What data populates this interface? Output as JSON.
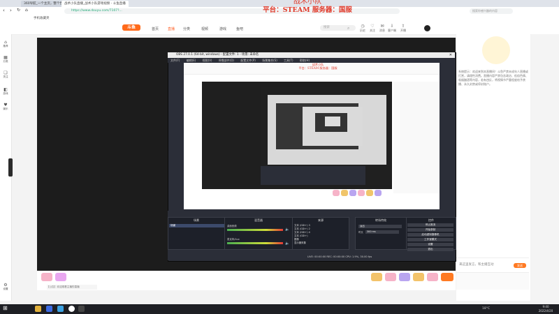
{
  "browser": {
    "tabs": [
      {
        "label": "360导航_一个主页，整个世界"
      },
      {
        "label": "战术小队直播_战术小队游戏视频 - 斗鱼直播"
      }
    ],
    "url": "https://www.douyu.com/7107?...",
    "bookmarks_label": "手机收藏夹",
    "search_placeholder": "搜索你感兴趣的内容"
  },
  "stream_overlay": {
    "title": "战术小队",
    "subtitle": "平台：STEAM  服务器：国服"
  },
  "site": {
    "logo_text": "斗鱼",
    "nav": [
      "首页",
      "直播",
      "分类",
      "视频",
      "游戏",
      "鱼吧"
    ],
    "search_placeholder": "搜索",
    "header_icons": [
      {
        "icon": "history-icon",
        "label": "历史"
      },
      {
        "icon": "follow-icon",
        "label": "关注"
      },
      {
        "icon": "message-icon",
        "label": "消息"
      },
      {
        "icon": "download-icon",
        "label": "客户端"
      },
      {
        "icon": "upload-icon",
        "label": "开播"
      }
    ]
  },
  "left_sidebar": [
    {
      "icon": "home-icon",
      "label": "推荐"
    },
    {
      "icon": "grid-icon",
      "label": "分类"
    },
    {
      "icon": "bookmark-icon",
      "label": "关注"
    },
    {
      "icon": "game-icon",
      "label": "游戏"
    },
    {
      "icon": "heart-icon",
      "label": "娱乐"
    },
    {
      "icon": "settings-icon",
      "label": "设置"
    }
  ],
  "obs": {
    "title": "OBS 27.0.1 (64-bit, windows) - 配置文件: 1 - 场景: 未命名",
    "menu": [
      "文件(F)",
      "编辑(E)",
      "视图(V)",
      "停靠部件(D)",
      "配置文件(P)",
      "场景集合(S)",
      "工具(T)",
      "帮助(H)"
    ],
    "panels": {
      "scenes": "场景",
      "sources": "来源",
      "mixer": "混音器",
      "transitions": "转场特效",
      "controls": "控件"
    },
    "scene_item": "场景",
    "source_items": [
      "文本 (GDI+) 3",
      "文本 (GDI+) 2",
      "文本 (GDI+) 4",
      "文本 (GDI+)",
      "图像",
      "显示器采集"
    ],
    "mixer_items": [
      "桌面音频",
      "麦克风/Aux"
    ],
    "transition_value": "淡出",
    "duration_label": "时长",
    "duration_value": "300 ms",
    "controls": [
      "停止推流",
      "开始录制",
      "启动虚拟摄像机",
      "工作室模式",
      "设置",
      "退出"
    ],
    "status": "LIVE: 00:00:00   REC: 00:00:00   CPU: 1.9%, 30.00 fps"
  },
  "below_player": {
    "notice": "【公告】欢迎观看主播的直播"
  },
  "right_panel": {
    "notice": "系统提示：欢迎来到本直播间！斗鱼严禁未成年人直播或打赏，请理性消费。直播内容严禁包含政治、低俗色情、吸烟酗酒等内容，若有违反，将视情节严重程度给予禁播、永久封禁或停封账户。",
    "chat_placeholder": "来这里发言，和主播互动",
    "send_label": "发送"
  },
  "taskbar": {
    "temperature": "18°C",
    "time": "9:40",
    "date": "2022/4/20"
  },
  "colors": {
    "brand": "#ff5d23",
    "overlay_text": "#e03a2a",
    "obs_bg": "#2b2e38"
  }
}
